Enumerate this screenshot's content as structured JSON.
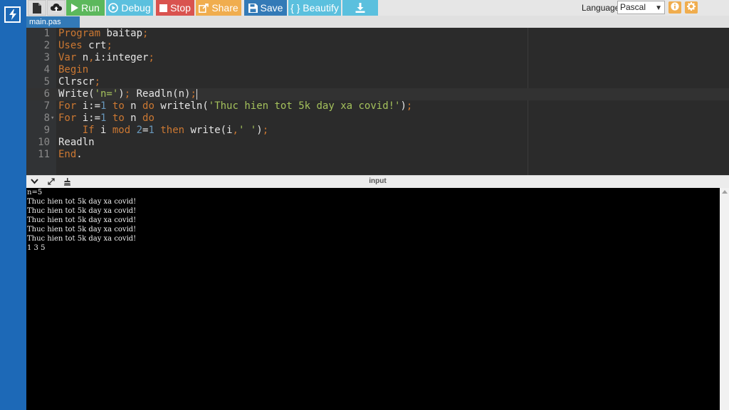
{
  "toolbar": {
    "run_label": "Run",
    "debug_label": "Debug",
    "stop_label": "Stop",
    "share_label": "Share",
    "save_label": "Save",
    "beautify_label": "{ } Beautify",
    "language_label": "Language",
    "language_value": "Pascal",
    "icons": [
      "new-file-icon",
      "upload-icon",
      "play-icon",
      "debug-icon",
      "stop-icon",
      "share-icon",
      "save-icon",
      "download-icon",
      "info-icon",
      "gear-icon"
    ],
    "colors": {
      "run": "#5cb85c",
      "debug": "#5bc0de",
      "stop": "#d9534f",
      "share": "#f0ad4e",
      "save": "#337ab7",
      "beautify": "#5bc0de",
      "download": "#5bc0de"
    }
  },
  "file_tab": "main.pas",
  "editor": {
    "lines": [
      {
        "n": "1",
        "code": "Program baitap;"
      },
      {
        "n": "2",
        "code": "Uses crt;"
      },
      {
        "n": "3",
        "code": "Var n,i:integer;"
      },
      {
        "n": "4",
        "code": "Begin"
      },
      {
        "n": "5",
        "code": "Clrscr;"
      },
      {
        "n": "6",
        "code": "Write('n='); Readln(n);"
      },
      {
        "n": "7",
        "code": "For i:=1 to n do writeln('Thuc hien tot 5k day xa covid!');"
      },
      {
        "n": "8",
        "code": "For i:=1 to n do"
      },
      {
        "n": "9",
        "code": "    If i mod 2=1 then write(i,' ');"
      },
      {
        "n": "10",
        "code": "Readln"
      },
      {
        "n": "11",
        "code": "End."
      }
    ]
  },
  "panel": {
    "title": "input"
  },
  "console": {
    "lines": [
      "n=5",
      "Thuc hien tot 5k day xa covid!",
      "Thuc hien tot 5k day xa covid!",
      "Thuc hien tot 5k day xa covid!",
      "Thuc hien tot 5k day xa covid!",
      "Thuc hien tot 5k day xa covid!",
      "1 3 5"
    ]
  }
}
